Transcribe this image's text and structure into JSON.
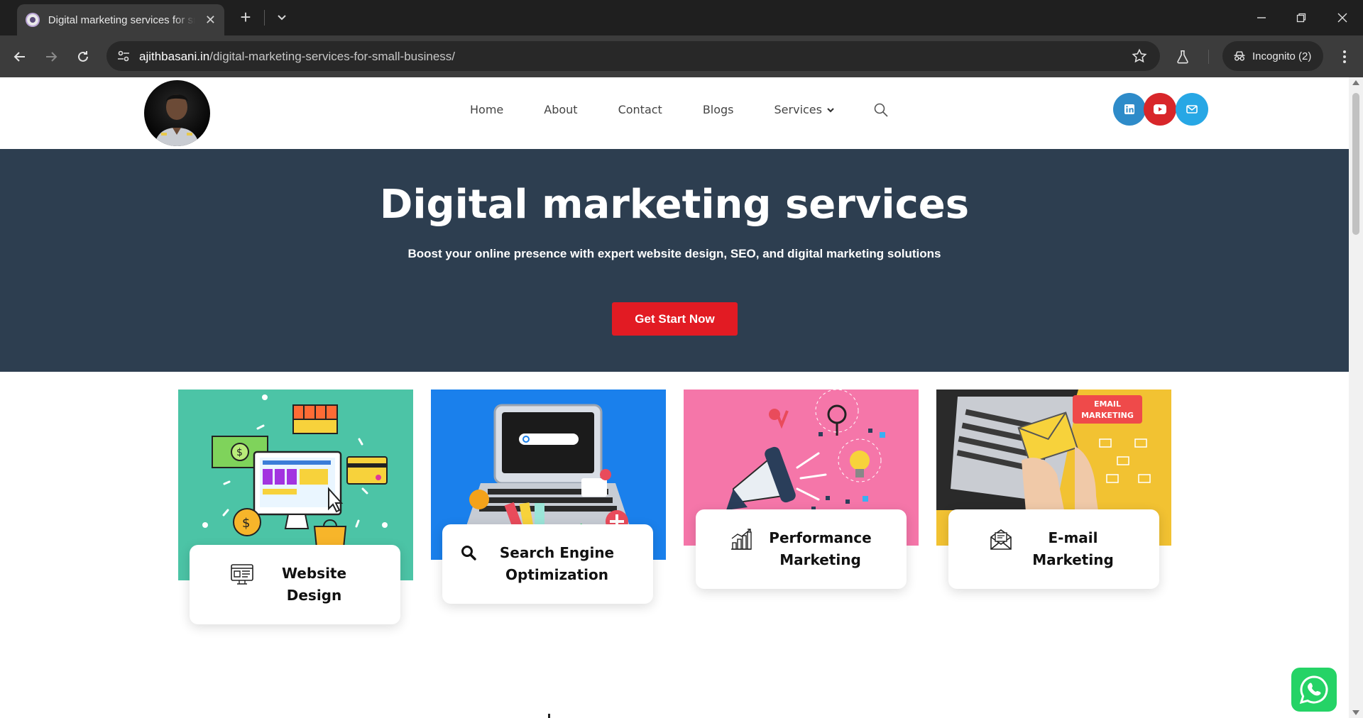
{
  "browser": {
    "tab_title": "Digital marketing services for small business",
    "url_host": "ajithbasani.in",
    "url_path": "/digital-marketing-services-for-small-business/",
    "incognito_label": "Incognito (2)"
  },
  "nav": {
    "items": [
      {
        "label": "Home"
      },
      {
        "label": "About"
      },
      {
        "label": "Contact"
      },
      {
        "label": "Blogs"
      },
      {
        "label": "Services"
      }
    ]
  },
  "social": {
    "icons": [
      "linkedin-icon",
      "youtube-icon",
      "email-icon"
    ],
    "colors": {
      "linkedin": "#2e8bc9",
      "youtube": "#d8262a",
      "email": "#27a7e5"
    }
  },
  "hero": {
    "title": "Digital marketing services",
    "subtitle": "Boost your online presence with expert website design, SEO, and digital marketing solutions",
    "cta": "Get Start Now",
    "bg_color": "#2d3e50",
    "cta_color": "#e21b23"
  },
  "services": [
    {
      "label": "Website Design",
      "icon": "website-design-icon",
      "image_bg": "#4cc4a6"
    },
    {
      "label": "Search Engine Optimization",
      "icon": "search-icon",
      "image_bg": "#1a7ae6"
    },
    {
      "label": "Performance Marketing",
      "icon": "bar-chart-icon",
      "image_bg": "#f576a9"
    },
    {
      "label": "E-mail Marketing",
      "icon": "email-envelope-icon",
      "image_bg": "#f2c232",
      "image_badge": "EMAIL MARKETING"
    }
  ]
}
